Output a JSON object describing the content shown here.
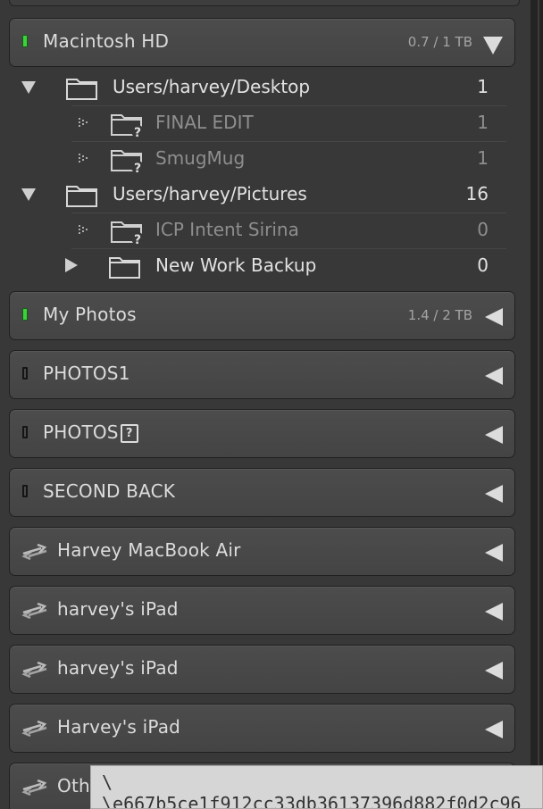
{
  "volumes": {
    "macintosh": {
      "name": "Macintosh HD",
      "capacity": "0.7 / 1 TB"
    },
    "myphotos": {
      "name": "My Photos",
      "capacity": "1.4 / 2 TB"
    },
    "photos1": {
      "name": "PHOTOS1"
    },
    "photos_q": {
      "name": "PHOTOS",
      "badge": "?"
    },
    "secondback": {
      "name": "SECOND BACK"
    },
    "macbookair": {
      "name": "Harvey MacBook Air"
    },
    "ipad1": {
      "name": "harvey's iPad"
    },
    "ipad2": {
      "name": "harvey's iPad"
    },
    "ipad3": {
      "name": "Harvey's iPad"
    },
    "other": {
      "name": "Oth"
    }
  },
  "folders": [
    {
      "name": "Users/harvey/Desktop",
      "count": "1"
    },
    {
      "name": "FINAL EDIT",
      "count": "1"
    },
    {
      "name": "SmugMug",
      "count": "1"
    },
    {
      "name": "Users/harvey/Pictures",
      "count": "16"
    },
    {
      "name": "ICP Intent Sirina",
      "count": "0"
    },
    {
      "name": "New Work Backup",
      "count": "0"
    }
  ],
  "tooltip": {
    "line1": "\\",
    "line2": "\\e667b5ce1f912cc33db36137396d882f0d2c96"
  },
  "colors": {
    "online_led": "#3ad33a",
    "panel_bg": "#383838"
  }
}
